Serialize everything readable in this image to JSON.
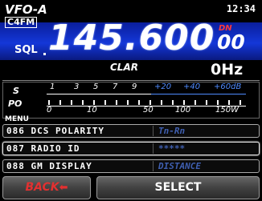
{
  "status": {
    "mode": "VFO-A",
    "time": "12:34",
    "digital_mode": "C4FM"
  },
  "frequency": {
    "sql_label": "SQL",
    "main": "145.600",
    "sub": "00",
    "dn_label": "DN"
  },
  "clarifier": {
    "label": "CLAR",
    "value": "0Hz"
  },
  "meter": {
    "s_label": "S",
    "po_label": "PO",
    "s_scale": [
      "1",
      "3",
      "5",
      "7",
      "9"
    ],
    "s_plus_scale": [
      "+20",
      "+40",
      "+60dB"
    ],
    "po_scale": [
      "0",
      "10",
      "50",
      "100",
      "150W"
    ]
  },
  "menu": {
    "title": "MENU",
    "items": [
      {
        "number": "086",
        "name": "DCS POLARITY",
        "value": "Tn-Rn"
      },
      {
        "number": "087",
        "name": "RADIO ID",
        "value": "*****"
      },
      {
        "number": "088",
        "name": "GM DISPLAY",
        "value": "DISTANCE"
      }
    ]
  },
  "buttons": {
    "back": "BACK",
    "select": "SELECT"
  }
}
